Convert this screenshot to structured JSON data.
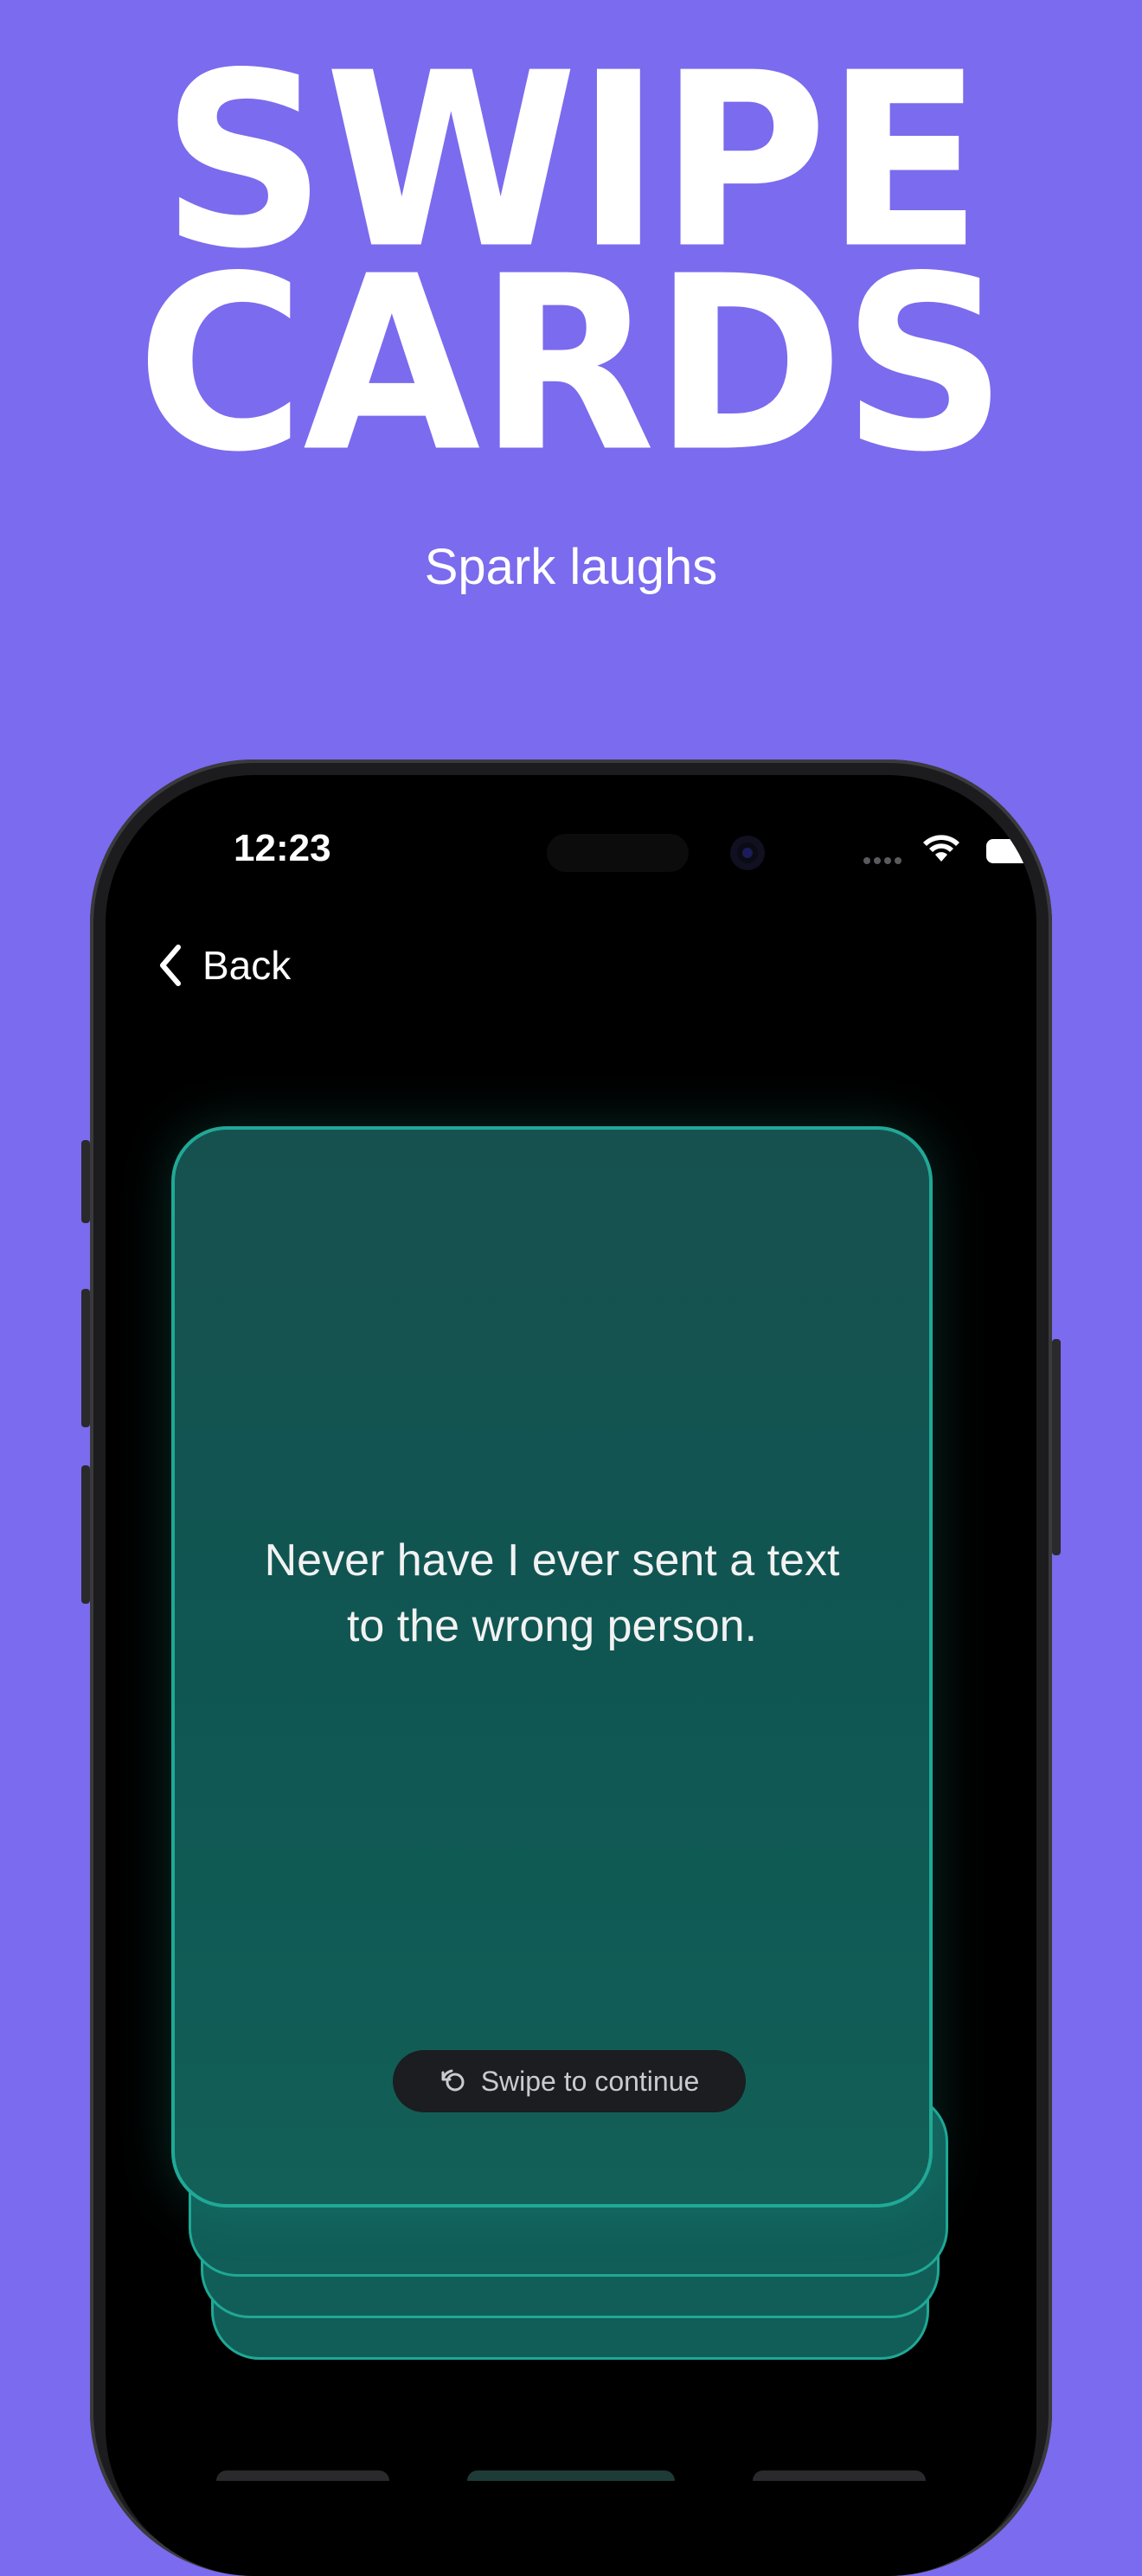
{
  "headline": {
    "line1": "SWIPE",
    "line2": "CARDS"
  },
  "subtitle": "Spark laughs",
  "status_bar": {
    "time": "12:23"
  },
  "nav": {
    "back_label": "Back"
  },
  "card": {
    "text": "Never have I ever sent a text\nto the wrong person."
  },
  "hint": {
    "label": "Swipe to continue"
  },
  "colors": {
    "background": "#7B6BEE",
    "card": "#0F5652",
    "card_border": "#20A997"
  }
}
